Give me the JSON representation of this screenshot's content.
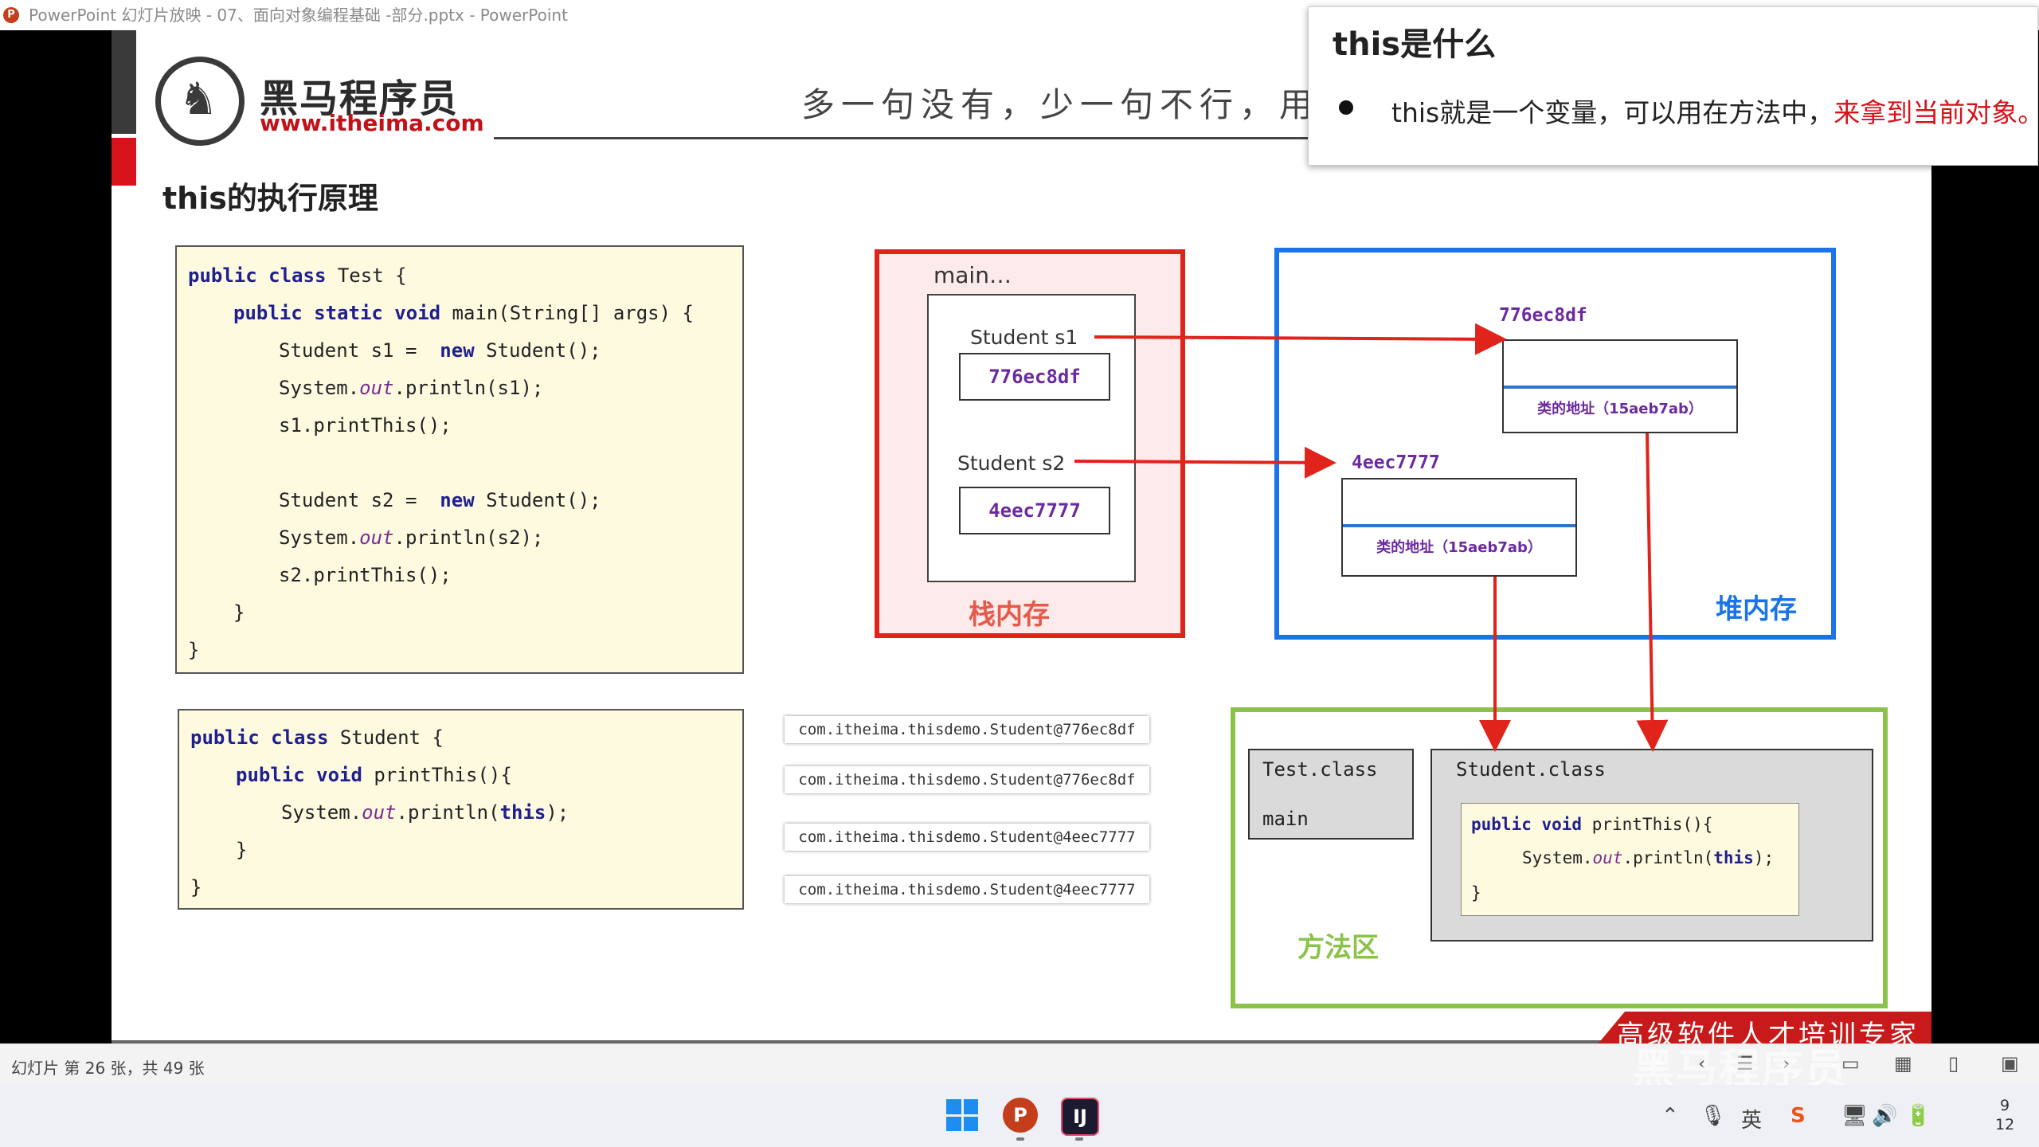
{
  "window": {
    "title": "PowerPoint 幻灯片放映  -  07、面向对象编程基础 -部分.pptx  -  PowerPoint",
    "app_icon": "powerpoint-icon"
  },
  "slide": {
    "logo": {
      "name": "黑马程序员",
      "url": "www.itheima.com"
    },
    "slogan": "多一句没有，少一句不行，用",
    "title": "this的执行原理",
    "test_code": [
      "public class Test {",
      "    public static void main(String[] args) {",
      "        Student s1 =  new Student();",
      "        System.out.println(s1);",
      "        s1.printThis();",
      "",
      "        Student s2 =  new Student();",
      "        System.out.println(s2);",
      "        s2.printThis();",
      "    }",
      "}"
    ],
    "student_code": [
      "public class Student {",
      "    public void printThis(){",
      "        System.out.println(this);",
      "    }",
      "}"
    ],
    "outputs": [
      "com.itheima.thisdemo.Student@776ec8df",
      "com.itheima.thisdemo.Student@776ec8df",
      "com.itheima.thisdemo.Student@4eec7777",
      "com.itheima.thisdemo.Student@4eec7777"
    ],
    "stack": {
      "frame_label": "main…",
      "var1_label": "Student  s1",
      "var1_value": "776ec8df",
      "var2_label": "Student  s2",
      "var2_value": "4eec7777",
      "label": "栈内存"
    },
    "heap": {
      "obj1_addr": "776ec8df",
      "obj1_class_addr": "类的地址（15aeb7ab）",
      "obj2_addr": "4eec7777",
      "obj2_class_addr": "类的地址（15aeb7ab）",
      "label": "堆内存"
    },
    "method_area": {
      "test_class": "Test.class",
      "test_main": "main",
      "student_class": "Student.class",
      "code": [
        "public void printThis(){",
        "    System.out.println(this);",
        "}"
      ],
      "label": "方法区"
    },
    "banner": "高级软件人才培训专家",
    "colors": {
      "stack": "#e0231b",
      "heap": "#1a73e8",
      "method": "#8bc34a",
      "arrow": "#e0231b"
    }
  },
  "popup": {
    "title": "this是什么",
    "text_normal": "this就是一个变量，可以用在方法中，",
    "text_red": "来拿到当前对象。"
  },
  "statusbar": {
    "slide_info": "幻灯片 第 26 张，共 49 张"
  },
  "watermark": "黑马程序员",
  "taskbar": {
    "clock_line1": "9",
    "clock_line2": "12",
    "ime": "英"
  }
}
